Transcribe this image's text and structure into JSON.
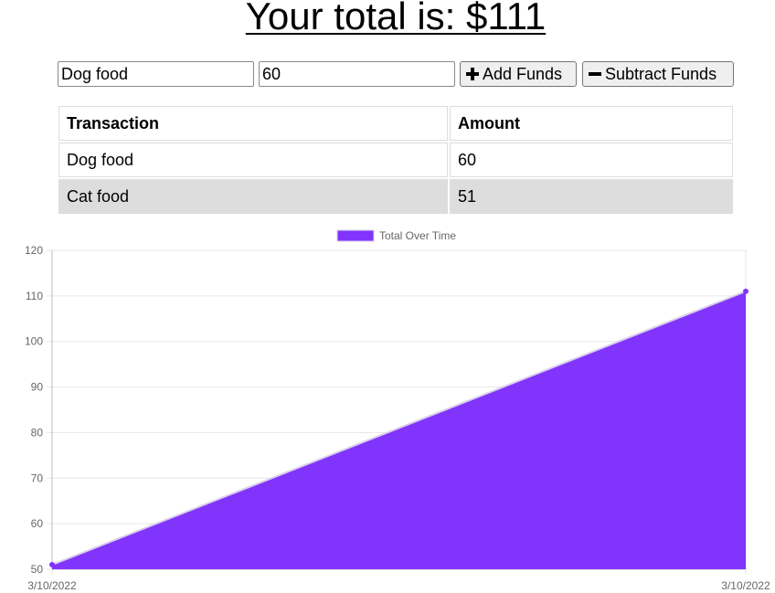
{
  "header": {
    "total_text": "Your total is: $111"
  },
  "form": {
    "name_value": "Dog food",
    "amount_value": "60",
    "add_label": "Add Funds",
    "subtract_label": "Subtract Funds"
  },
  "table": {
    "headers": [
      "Transaction",
      "Amount"
    ],
    "rows": [
      {
        "name": "Dog food",
        "amount": "60"
      },
      {
        "name": "Cat food",
        "amount": "51"
      }
    ]
  },
  "chart_data": {
    "type": "area",
    "x": [
      "3/10/2022",
      "3/10/2022"
    ],
    "series": [
      {
        "name": "Total Over Time",
        "values": [
          51,
          111
        ]
      }
    ],
    "ylim": [
      50,
      120
    ],
    "yticks": [
      50,
      60,
      70,
      80,
      90,
      100,
      110,
      120
    ],
    "grid": true,
    "legend": "top-center",
    "fill_color": "#8134fc",
    "line_color": "#d9cfe9"
  }
}
